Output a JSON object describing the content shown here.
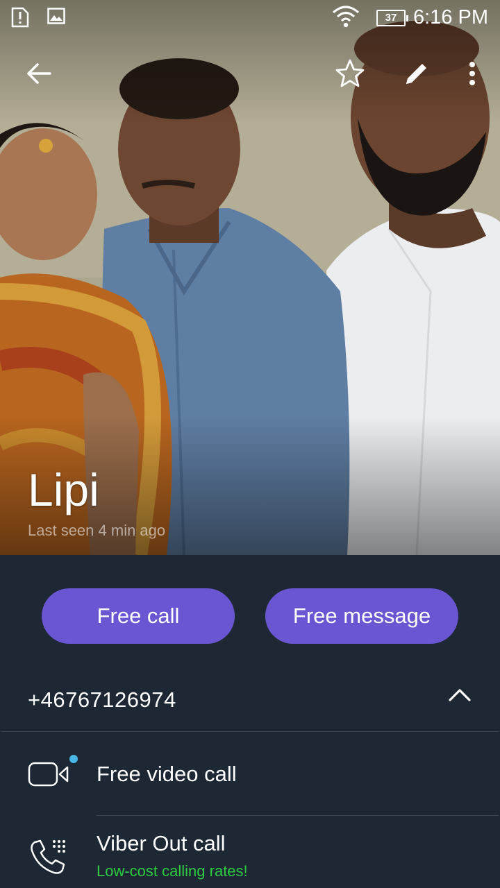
{
  "status_bar": {
    "battery": "37",
    "time": "6:16 PM",
    "icons": [
      "sim-alert-icon",
      "image-icon",
      "wifi-icon",
      "battery-icon"
    ]
  },
  "toolbar": {
    "icons": [
      "back-arrow-icon",
      "star-icon",
      "edit-pencil-icon",
      "more-vert-icon"
    ]
  },
  "contact": {
    "name": "Lipi",
    "last_seen": "Last seen 4 min ago",
    "phone": "+46767126974"
  },
  "actions": {
    "free_call": "Free call",
    "free_message": "Free message"
  },
  "options": [
    {
      "label": "Free video call",
      "icon": "video-camera-icon",
      "has_new_dot": true
    },
    {
      "label": "Viber Out call",
      "sub": "Low-cost calling rates!",
      "icon": "phone-dialpad-icon"
    }
  ],
  "colors": {
    "background": "#1e2734",
    "accent": "#6a55d3",
    "sub_text_green": "#2ecc40",
    "new_dot": "#4ab6e6"
  }
}
